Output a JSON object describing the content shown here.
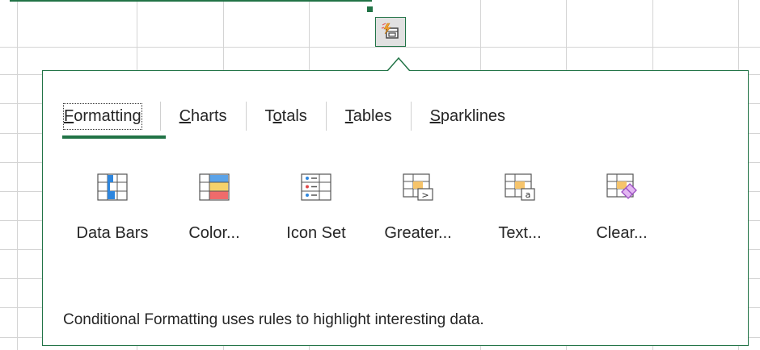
{
  "colors": {
    "accent": "#217346",
    "grid": "#d4d4d4",
    "text": "#262626"
  },
  "quick_analysis": {
    "icon": "quick-analysis-icon"
  },
  "popup": {
    "tabs": [
      {
        "label_before": "",
        "mnemonic": "F",
        "label_after": "ormatting",
        "active": true
      },
      {
        "label_before": "",
        "mnemonic": "C",
        "label_after": "harts",
        "active": false
      },
      {
        "label_before": "T",
        "mnemonic": "o",
        "label_after": "tals",
        "active": false
      },
      {
        "label_before": "",
        "mnemonic": "T",
        "label_after": "ables",
        "active": false
      },
      {
        "label_before": "",
        "mnemonic": "S",
        "label_after": "parklines",
        "active": false
      }
    ],
    "tools": [
      {
        "label": "Data Bars",
        "icon": "data-bars-icon"
      },
      {
        "label": "Color...",
        "icon": "color-scale-icon"
      },
      {
        "label": "Icon Set",
        "icon": "icon-set-icon"
      },
      {
        "label": "Greater...",
        "icon": "greater-than-icon"
      },
      {
        "label": "Text...",
        "icon": "text-contains-icon"
      },
      {
        "label": "Clear...",
        "icon": "clear-format-icon"
      }
    ],
    "description": "Conditional Formatting uses rules to highlight interesting data."
  }
}
